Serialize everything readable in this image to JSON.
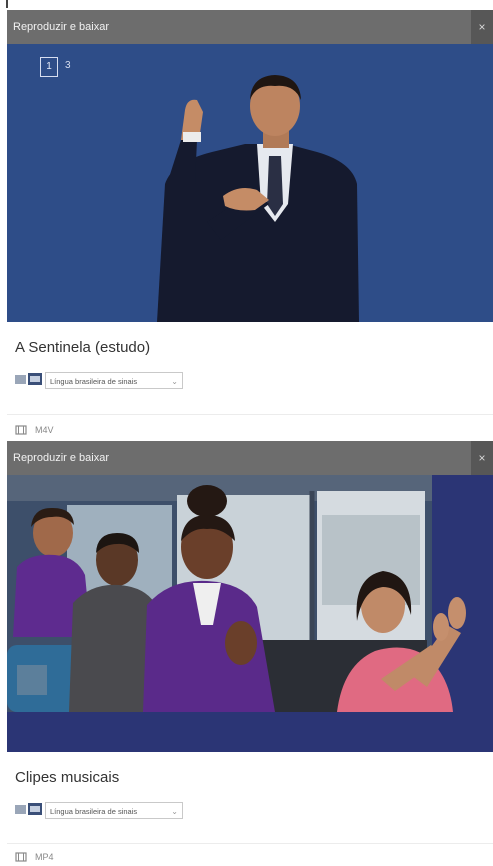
{
  "cards": [
    {
      "header_label": "Reproduzir e baixar",
      "close_label": "×",
      "pager": {
        "current": "1",
        "next": "3"
      },
      "title": "A Sentinela (estudo)",
      "language": "Língua brasileira de sinais",
      "format": "M4V"
    },
    {
      "header_label": "Reproduzir e baixar",
      "close_label": "×",
      "title": "Clipes musicais",
      "language": "Língua brasileira de sinais",
      "format": "MP4"
    }
  ]
}
